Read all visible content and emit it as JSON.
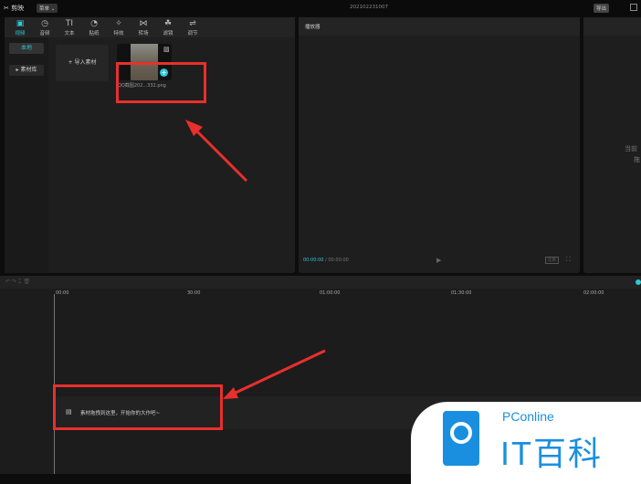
{
  "app": {
    "name": "剪映",
    "menu": "菜单",
    "project_title": "202102231007",
    "export": "导出"
  },
  "tabs": [
    {
      "label": "视频",
      "icon": "▣"
    },
    {
      "label": "音频",
      "icon": "◷"
    },
    {
      "label": "文本",
      "icon": "TI"
    },
    {
      "label": "贴纸",
      "icon": "◔"
    },
    {
      "label": "特效",
      "icon": "✧"
    },
    {
      "label": "转场",
      "icon": "⋈"
    },
    {
      "label": "滤镜",
      "icon": "☘"
    },
    {
      "label": "调节",
      "icon": "⇌"
    }
  ],
  "sidebar": {
    "local": "本地",
    "library": "素材库"
  },
  "media": {
    "import": "导入素材",
    "file": "QQ截图202...332.png"
  },
  "player": {
    "title": "播放器",
    "current": "00:00:00",
    "total": "00:00:00",
    "ratio": "比例"
  },
  "right_panel": {
    "text1": "当前",
    "text2": "拖"
  },
  "timeline": {
    "ticks": [
      "00:00",
      "30:00",
      "01:00:00",
      "01:30:00",
      "02:00:00"
    ],
    "drop_hint": "素材拖拽到这里，开始你的大作吧~"
  },
  "watermark": {
    "brand": "PConline",
    "name": "IT百科"
  }
}
